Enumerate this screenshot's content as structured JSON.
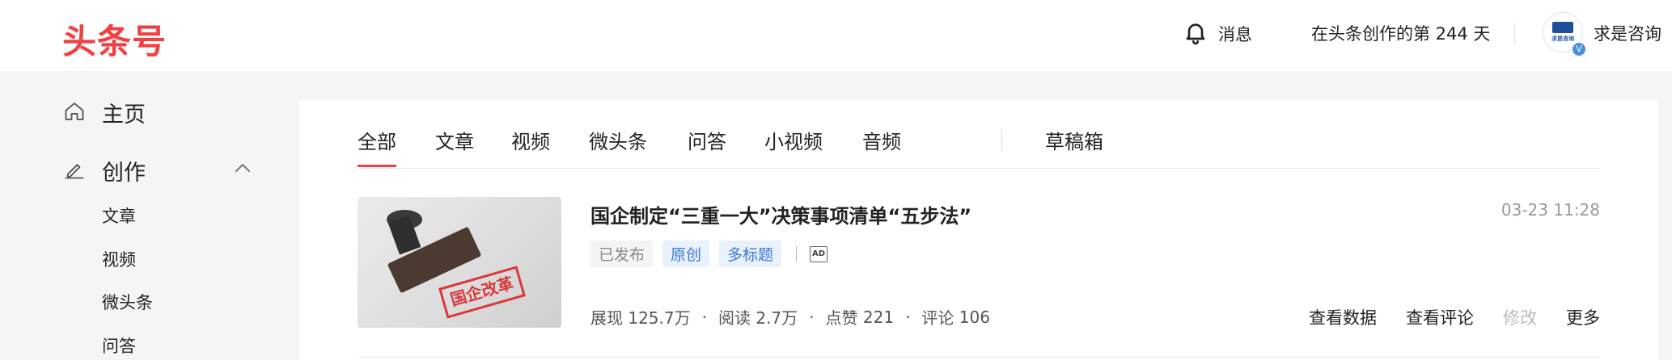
{
  "header": {
    "logo": "头条号",
    "message_label": "消息",
    "creation_days": "在头条创作的第 244 天",
    "avatar_text": "求是咨询",
    "verified_badge": "V",
    "username": "求是咨询"
  },
  "sidebar": {
    "home": {
      "label": "主页",
      "icon": "home-icon"
    },
    "create": {
      "label": "创作",
      "icon": "pen-icon",
      "expanded": true
    },
    "sub_items": [
      "文章",
      "视频",
      "微头条",
      "问答"
    ]
  },
  "tabs": [
    {
      "label": "全部",
      "active": true
    },
    {
      "label": "文章"
    },
    {
      "label": "视频"
    },
    {
      "label": "微头条"
    },
    {
      "label": "问答"
    },
    {
      "label": "小视频"
    },
    {
      "label": "音频"
    },
    {
      "label": "草稿箱"
    }
  ],
  "article": {
    "title": "国企制定“三重一大”决策事项清单“五步法”",
    "time": "03-23 11:28",
    "thumbnail_stamp_text": "国企改革",
    "tags": [
      "已发布",
      "原创",
      "多标题"
    ],
    "ad_label": "AD",
    "stats": [
      {
        "label": "展现",
        "value": "125.7万"
      },
      {
        "label": "阅读",
        "value": "2.7万"
      },
      {
        "label": "点赞",
        "value": "221"
      },
      {
        "label": "评论",
        "value": "106"
      }
    ],
    "actions": [
      "查看数据",
      "查看评论",
      "修改",
      "更多"
    ]
  },
  "colors": {
    "brand": "#f04142",
    "tag_blue": "#3b78d8",
    "muted": "#999999"
  }
}
